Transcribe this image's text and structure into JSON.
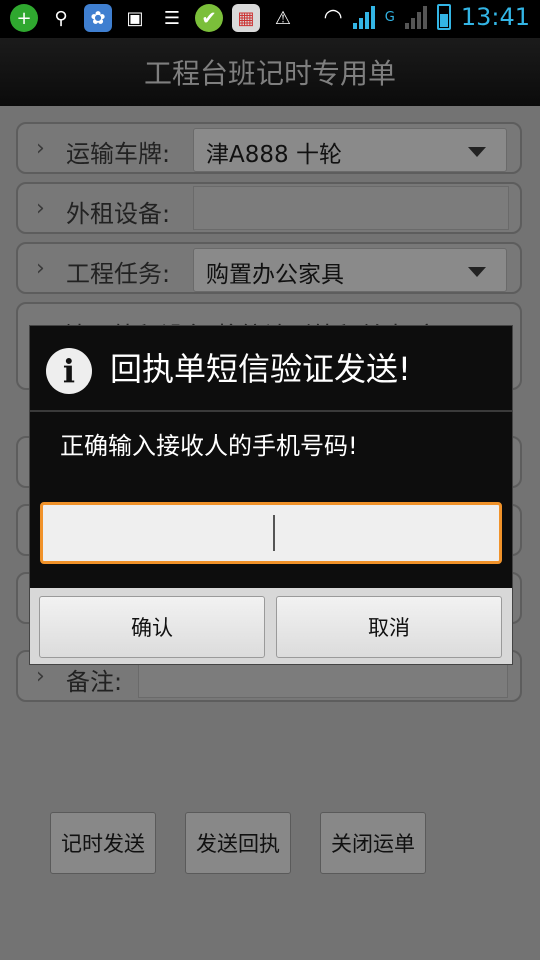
{
  "status_bar": {
    "time": "13:41",
    "network_label": "G",
    "left_icons": [
      "plus-circle-icon",
      "usb-icon",
      "app-butterfly-icon",
      "image-icon",
      "chat-icon",
      "app-green-icon",
      "app-calendar-icon",
      "warning-icon"
    ],
    "colors": {
      "accent": "#33b5e5"
    }
  },
  "app": {
    "title": "工程台班记时专用单"
  },
  "form": {
    "vehicle_label": "运输车牌:",
    "vehicle_value": "津A888 十轮",
    "rental_label": "外租设备:",
    "task_label": "工程任务:",
    "task_value": "购置办公家具",
    "hint_visible": "填写外租设备,将统计到外租单中,空",
    "remarks_label": "备注:"
  },
  "bottom_buttons": {
    "timing_send": "记时发送",
    "send_receipt": "发送回执",
    "close_waybill": "关闭运单"
  },
  "dialog": {
    "title": "回执单短信验证发送!",
    "message": "正确输入接收人的手机号码!",
    "input_value": "",
    "confirm": "确认",
    "cancel": "取消",
    "colors": {
      "input_border": "#f0922a"
    }
  }
}
